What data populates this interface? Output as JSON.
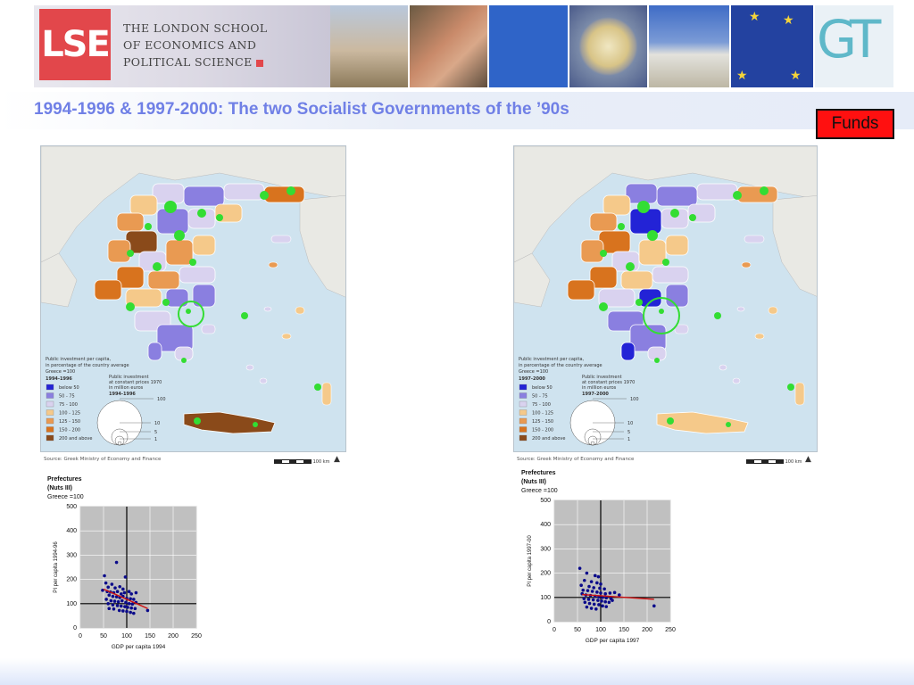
{
  "header": {
    "logo_text": "LSE",
    "school_line1": "THE LONDON SCHOOL",
    "school_line2": "OF ECONOMICS AND",
    "school_line3": "POLITICAL SCIENCE",
    "right_logo_text": "GT",
    "photos": [
      "acropolis-photo",
      "people-photo",
      "blue-panel",
      "euro-coin-photo",
      "parliament-photo",
      "greek-flag-photo"
    ]
  },
  "slide": {
    "title": "1994-1996 & 1997-2000:  The two Socialist Governments of the ’90s",
    "funds_button": "Funds"
  },
  "maps": [
    {
      "legend_title_line1": "Public investment per capita,",
      "legend_title_line2": "in percentage of the country average",
      "legend_title_line3": "Greece =100",
      "period": "1994-1996",
      "bubble_title_line1": "Public investment",
      "bubble_title_line2": "at constant prices 1970",
      "bubble_title_line3": "in million euros",
      "bubble_period": "1994-1996",
      "bubble_values": [
        "100",
        "10",
        "5",
        "1"
      ],
      "classes": [
        "below 50",
        "50 - 75",
        "75 - 100",
        "100 - 125",
        "125 - 150",
        "150 - 200",
        "200 and above"
      ],
      "source": "Source: Greek Ministry of Economy and Finance",
      "scale": [
        "0",
        "50",
        "100 km"
      ],
      "north": "N"
    },
    {
      "legend_title_line1": "Public investment per capita,",
      "legend_title_line2": "in percentage of the country average",
      "legend_title_line3": "Greece =100",
      "period": "1997-2000",
      "bubble_title_line1": "Public investment",
      "bubble_title_line2": "at constant prices 1970",
      "bubble_title_line3": "in million euros",
      "bubble_period": "1997-2000",
      "bubble_values": [
        "100",
        "10",
        "5",
        "1"
      ],
      "classes": [
        "below 50",
        "50 - 75",
        "75 - 100",
        "100 - 125",
        "125 - 150",
        "150 - 200",
        "200 and above"
      ],
      "source": "Source: Greek Ministry of Economy and Finance",
      "scale": [
        "0",
        "50",
        "100 km"
      ],
      "north": "N"
    }
  ],
  "colors": {
    "title": "#7080e6",
    "funds_bg": "#ff1010",
    "sea": "#cfe3ef",
    "land_other": "#e9e9e4",
    "class_colors": [
      "#2323d6",
      "#8a7fe0",
      "#d9d2ef",
      "#f5c98a",
      "#e99a52",
      "#d8731e",
      "#8a4a1a"
    ],
    "bubble": "#33dd33",
    "scatter_point": "#0a0a8a",
    "trend_line": "#d01010",
    "plot_bg": "#c0c0c0"
  },
  "chart_data": [
    {
      "type": "scatter",
      "title_line1": "Prefectures",
      "title_line2": "(Nuts III)",
      "title_line3": "Greece =100",
      "xlabel": "GDP per capita  1994",
      "ylabel": "PI per capita 1994-96",
      "xlim": [
        0,
        250
      ],
      "ylim": [
        0,
        500
      ],
      "xticks": [
        0,
        50,
        100,
        150,
        200,
        250
      ],
      "yticks": [
        0,
        100,
        200,
        300,
        400,
        500
      ],
      "reference_lines": {
        "x": 100,
        "y": 100
      },
      "points": [
        [
          52,
          215
        ],
        [
          78,
          270
        ],
        [
          97,
          210
        ],
        [
          55,
          185
        ],
        [
          68,
          180
        ],
        [
          60,
          168
        ],
        [
          75,
          165
        ],
        [
          85,
          170
        ],
        [
          92,
          160
        ],
        [
          48,
          155
        ],
        [
          58,
          150
        ],
        [
          65,
          148
        ],
        [
          72,
          145
        ],
        [
          80,
          150
        ],
        [
          88,
          140
        ],
        [
          95,
          145
        ],
        [
          105,
          150
        ],
        [
          110,
          140
        ],
        [
          120,
          145
        ],
        [
          62,
          135
        ],
        [
          70,
          130
        ],
        [
          78,
          128
        ],
        [
          85,
          125
        ],
        [
          92,
          130
        ],
        [
          100,
          122
        ],
        [
          108,
          120
        ],
        [
          115,
          118
        ],
        [
          56,
          118
        ],
        [
          66,
          112
        ],
        [
          74,
          110
        ],
        [
          82,
          108
        ],
        [
          90,
          112
        ],
        [
          98,
          105
        ],
        [
          105,
          100
        ],
        [
          112,
          98
        ],
        [
          60,
          100
        ],
        [
          70,
          95
        ],
        [
          80,
          92
        ],
        [
          88,
          90
        ],
        [
          96,
          88
        ],
        [
          102,
          85
        ],
        [
          110,
          82
        ],
        [
          118,
          80
        ],
        [
          62,
          80
        ],
        [
          72,
          78
        ],
        [
          84,
          72
        ],
        [
          92,
          70
        ],
        [
          100,
          68
        ],
        [
          108,
          64
        ],
        [
          115,
          60
        ],
        [
          145,
          72
        ],
        [
          120,
          105
        ]
      ],
      "trend": {
        "x": [
          50,
          145
        ],
        "y": [
          160,
          80
        ]
      }
    },
    {
      "type": "scatter",
      "title_line1": "Prefectures",
      "title_line2": "(Nuts III)",
      "title_line3": "Greece =100",
      "xlabel": "GDP per capita 1997",
      "ylabel": "PI per capita 1997-00",
      "xlim": [
        0,
        250
      ],
      "ylim": [
        0,
        500
      ],
      "xticks": [
        0,
        50,
        100,
        150,
        200,
        250
      ],
      "yticks": [
        0,
        100,
        200,
        300,
        400,
        500
      ],
      "reference_lines": {
        "x": 100,
        "y": 100
      },
      "points": [
        [
          55,
          220
        ],
        [
          70,
          200
        ],
        [
          88,
          190
        ],
        [
          95,
          185
        ],
        [
          65,
          170
        ],
        [
          80,
          165
        ],
        [
          92,
          160
        ],
        [
          100,
          155
        ],
        [
          58,
          150
        ],
        [
          75,
          145
        ],
        [
          85,
          140
        ],
        [
          98,
          138
        ],
        [
          108,
          135
        ],
        [
          62,
          130
        ],
        [
          72,
          128
        ],
        [
          82,
          125
        ],
        [
          92,
          122
        ],
        [
          100,
          118
        ],
        [
          110,
          115
        ],
        [
          120,
          118
        ],
        [
          130,
          120
        ],
        [
          60,
          115
        ],
        [
          68,
          110
        ],
        [
          78,
          108
        ],
        [
          88,
          105
        ],
        [
          96,
          102
        ],
        [
          104,
          100
        ],
        [
          112,
          98
        ],
        [
          122,
          95
        ],
        [
          64,
          95
        ],
        [
          74,
          92
        ],
        [
          84,
          90
        ],
        [
          94,
          88
        ],
        [
          102,
          85
        ],
        [
          110,
          82
        ],
        [
          118,
          80
        ],
        [
          66,
          80
        ],
        [
          76,
          75
        ],
        [
          86,
          72
        ],
        [
          96,
          70
        ],
        [
          104,
          65
        ],
        [
          112,
          62
        ],
        [
          70,
          60
        ],
        [
          80,
          55
        ],
        [
          90,
          52
        ],
        [
          215,
          65
        ],
        [
          140,
          110
        ],
        [
          125,
          88
        ]
      ],
      "trend": {
        "x": [
          60,
          215
        ],
        "y": [
          112,
          92
        ]
      }
    }
  ]
}
